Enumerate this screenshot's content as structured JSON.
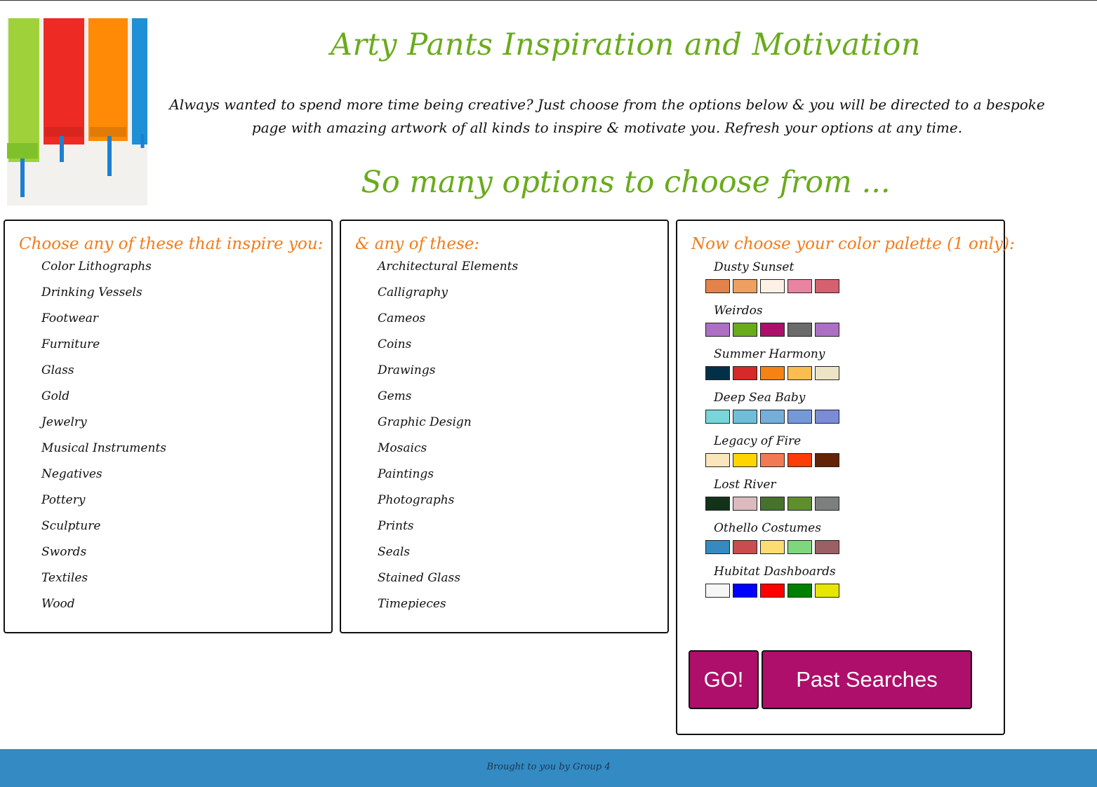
{
  "header": {
    "title": "Arty Pants Inspiration and Motivation",
    "intro": "Always wanted to spend more time being creative? Just choose from the options below & you will be directed to a bespoke page with amazing artwork of all kinds to inspire & motivate you. Refresh your options at any time.",
    "subtitle": "So many options to choose from ..."
  },
  "hero_image": {
    "icon": "paint-rollers-image",
    "colors": [
      "#9fd23a",
      "#ee2a24",
      "#ff8a05",
      "#1e90d6"
    ]
  },
  "panel1": {
    "heading": "Choose any of these that inspire you:",
    "items": [
      "Color Lithographs",
      "Drinking Vessels",
      "Footwear",
      "Furniture",
      "Glass",
      "Gold",
      "Jewelry",
      "Musical Instruments",
      "Negatives",
      "Pottery",
      "Sculpture",
      "Swords",
      "Textiles",
      "Wood"
    ]
  },
  "panel2": {
    "heading": "& any of these:",
    "items": [
      "Architectural Elements",
      "Calligraphy",
      "Cameos",
      "Coins",
      "Drawings",
      "Gems",
      "Graphic Design",
      "Mosaics",
      "Paintings",
      "Photographs",
      "Prints",
      "Seals",
      "Stained Glass",
      "Timepieces"
    ]
  },
  "panel3": {
    "heading": "Now choose your color palette (1 only):",
    "palettes": [
      {
        "name": "Dusty Sunset",
        "colors": [
          "#e3834b",
          "#eda060",
          "#fdf1e6",
          "#e883a0",
          "#d5606e"
        ]
      },
      {
        "name": "Weirdos",
        "colors": [
          "#ad6fc4",
          "#6aab1c",
          "#ad0f6b",
          "#6b6b6b",
          "#ad6fc4"
        ]
      },
      {
        "name": "Summer Harmony",
        "colors": [
          "#033049",
          "#d62929",
          "#f78214",
          "#fbbd4f",
          "#ede4c5"
        ]
      },
      {
        "name": "Deep Sea Baby",
        "colors": [
          "#76d6da",
          "#6dbfd9",
          "#73afda",
          "#7598d8",
          "#7a8bd7"
        ]
      },
      {
        "name": "Legacy of Fire",
        "colors": [
          "#fae5bc",
          "#fed500",
          "#f17a55",
          "#fd3c07",
          "#622307"
        ]
      },
      {
        "name": "Lost River",
        "colors": [
          "#12331a",
          "#dbbbbe",
          "#46722e",
          "#5e8f2b",
          "#7c7f7e"
        ]
      },
      {
        "name": "Othello Costumes",
        "colors": [
          "#358ac2",
          "#c94c4e",
          "#fddd73",
          "#7ed67e",
          "#9b6063"
        ]
      },
      {
        "name": "Hubitat Dashboards",
        "colors": [
          "#f6f6f6",
          "#0000fe",
          "#fe0000",
          "#007f01",
          "#e6e600"
        ]
      }
    ]
  },
  "buttons": {
    "go": "GO!",
    "past_searches": "Past Searches"
  },
  "footer": {
    "text": "Brought to you by Group 4"
  },
  "colors": {
    "title_green": "#6aab1c",
    "heading_orange": "#f07c1c",
    "button_magenta": "#ad0f6b",
    "footer_blue": "#348ac2"
  }
}
